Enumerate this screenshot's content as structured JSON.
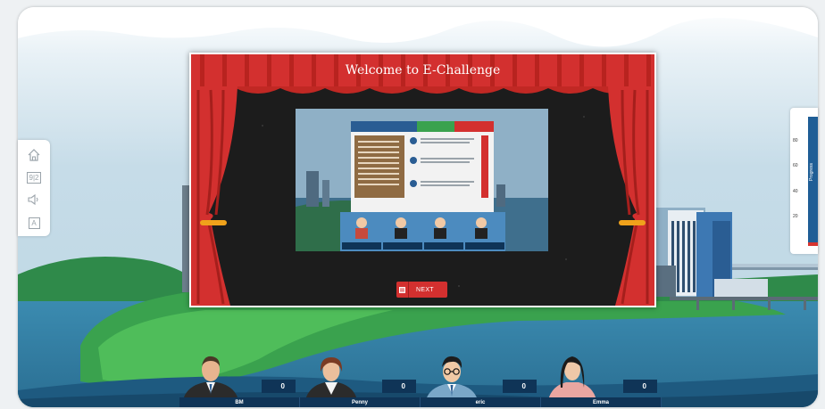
{
  "modal": {
    "title": "Welcome to E-Challenge",
    "next_label": "NEXT"
  },
  "toolbar": {
    "items": [
      {
        "icon": "home-icon"
      },
      {
        "icon": "scoreboard-icon",
        "text": "9|2"
      },
      {
        "icon": "speaker-icon"
      },
      {
        "icon": "text-size-icon",
        "text": "A"
      }
    ]
  },
  "progress": {
    "label": "Progress",
    "ticks": [
      "80",
      "60",
      "40",
      "20"
    ],
    "value_percent": 3
  },
  "team": [
    {
      "name": "BM",
      "score": "0"
    },
    {
      "name": "Penny",
      "score": "0"
    },
    {
      "name": "eric",
      "score": "0"
    },
    {
      "name": "Emma",
      "score": "0"
    }
  ],
  "colors": {
    "sky": "#c9dde8",
    "curtain_red": "#d3302f",
    "navy": "#0f3457",
    "next_button": "#d3302f"
  }
}
